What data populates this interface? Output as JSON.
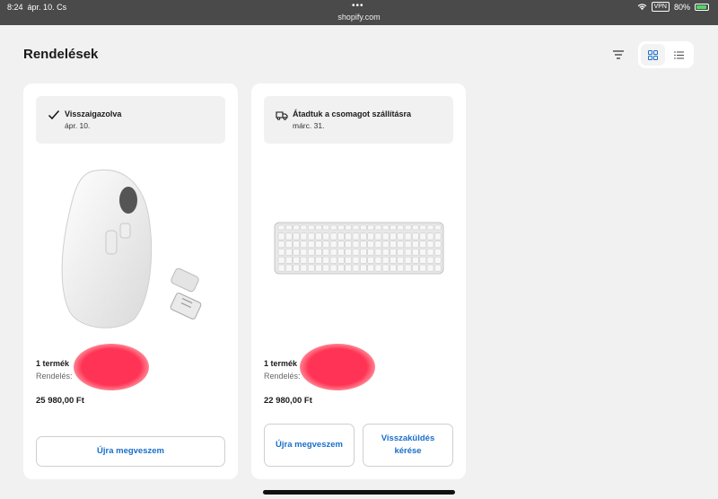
{
  "statusbar": {
    "time": "8:24",
    "date": "ápr. 10. Cs",
    "url": "shopify.com",
    "vpn": "VPN",
    "battery": "80%",
    "battery_level": 0.8
  },
  "header": {
    "title": "Rendelések",
    "filter_icon": "filter-icon",
    "view_grid_icon": "grid-view-icon",
    "view_list_icon": "list-view-icon"
  },
  "orders": [
    {
      "status_title": "Visszaigazolva",
      "status_date": "ápr. 10.",
      "status_icon": "checkmark-icon",
      "item_count": "1 termék",
      "order_label": "Rendelés:",
      "price": "25 980,00 Ft",
      "buttons": {
        "rebuy": "Újra megveszem"
      }
    },
    {
      "status_title": "Átadtuk a csomagot szállításra",
      "status_date": "márc. 31.",
      "status_icon": "delivery-truck-icon",
      "item_count": "1 termék",
      "order_label": "Rendelés:",
      "price": "22 980,00 Ft",
      "buttons": {
        "rebuy": "Újra megveszem",
        "return": "Visszaküldés kérése"
      }
    }
  ],
  "colors": {
    "accent": "#1a6fc9",
    "background": "#f1f1f1",
    "redaction": "#ff3355"
  }
}
